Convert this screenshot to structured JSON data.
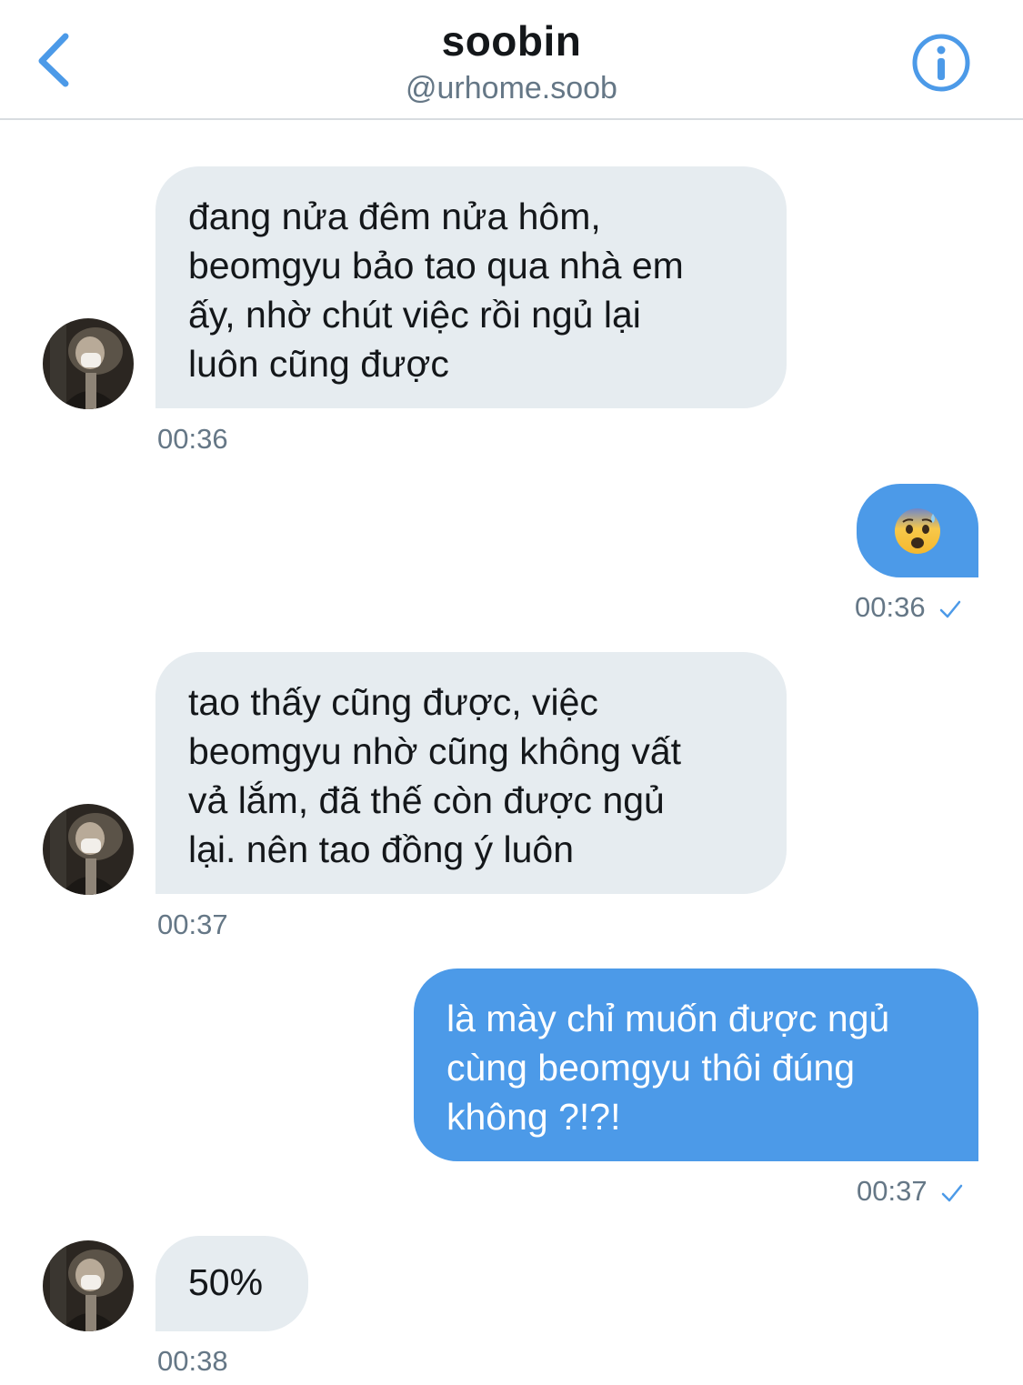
{
  "header": {
    "name": "soobin",
    "handle": "@urhome.soob",
    "back_icon": "chevron-left-icon",
    "info_icon": "info-icon",
    "accent": "#4c9ae8"
  },
  "messages": [
    {
      "direction": "in",
      "text": "đang nửa đêm nửa hôm,\nbeomgyu bảo tao qua nhà em\nấy, nhờ chút việc rồi ngủ lại\nluôn cũng được",
      "time": "00:36"
    },
    {
      "direction": "out",
      "emoji": "anxious-face-with-sweat",
      "time": "00:36",
      "read": true
    },
    {
      "direction": "in",
      "text": "tao thấy cũng được, việc\nbeomgyu nhờ cũng không vất\nvả lắm, đã thế còn được ngủ\nlại. nên tao đồng ý luôn",
      "time": "00:37"
    },
    {
      "direction": "out",
      "text": "là mày chỉ muốn được ngủ\ncùng beomgyu thôi đúng\nkhông ?!?!",
      "time": "00:37",
      "read": true
    },
    {
      "direction": "in",
      "text": "50%",
      "time": "00:38"
    }
  ],
  "colors": {
    "incoming_bubble": "#e6ecf0",
    "outgoing_bubble": "#4c9ae8",
    "timestamp": "#657786"
  }
}
